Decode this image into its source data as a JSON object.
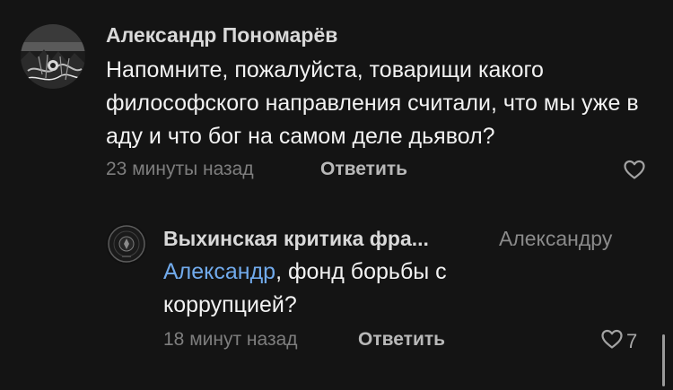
{
  "comments": [
    {
      "author": "Александр Пономарёв",
      "text": "Напомните, пожалуйста, товарищи какого философского направления считали, что мы уже в аду и что бог на самом деле дьявол?",
      "time": "23 минуты назад",
      "reply_label": "Ответить",
      "like_icon": "heart-outline-icon"
    },
    {
      "author": "Выхинская критика фра...",
      "reply_to": "Александру",
      "mention": "Александр",
      "text": ", фонд борьбы с коррупцией?",
      "time": "18 минут назад",
      "reply_label": "Ответить",
      "like_icon": "heart-outline-icon",
      "like_count": "7"
    }
  ],
  "colors": {
    "background": "#141414",
    "mention": "#71aaeb",
    "muted": "#7e7e7e"
  }
}
